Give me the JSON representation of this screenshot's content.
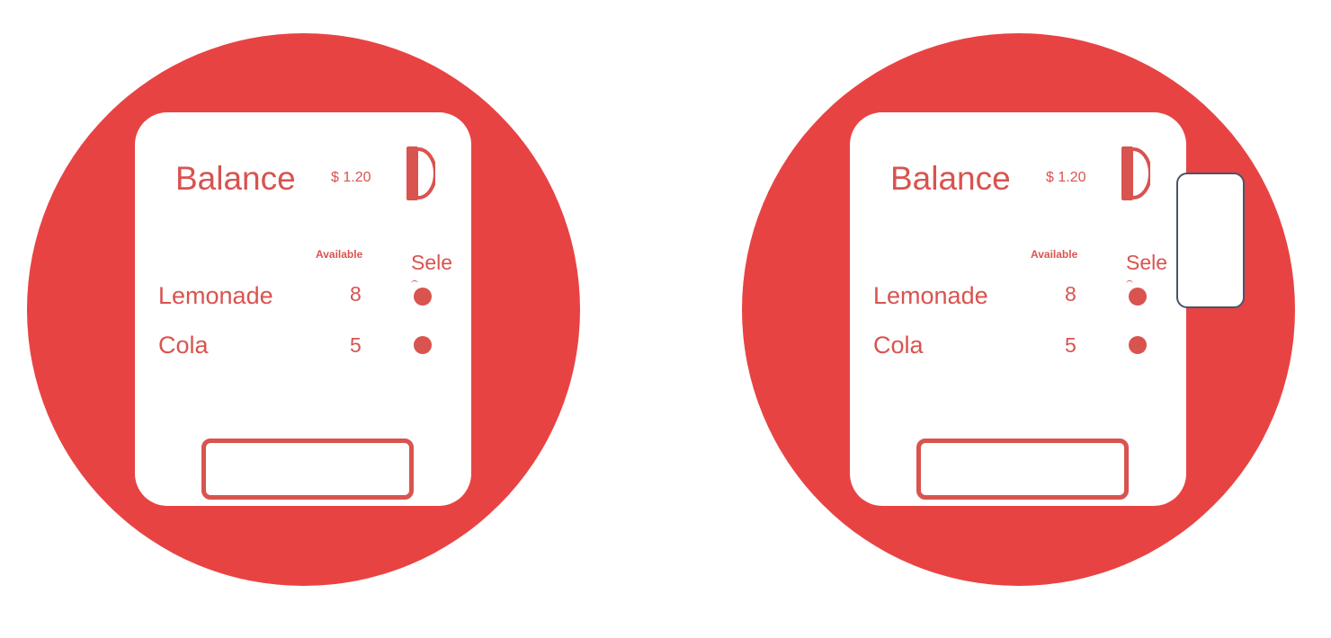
{
  "colors": {
    "machine": "#e84343",
    "text": "#d9534f",
    "panel": "#ffffff",
    "cup_border": "#4a5468"
  },
  "machines": [
    {
      "balance_label": "Balance",
      "balance_value": "$ 1.20",
      "available_header": "Available",
      "select_header": "Sele",
      "items": [
        {
          "name": "Lemonade",
          "available": "8"
        },
        {
          "name": "Cola",
          "available": "5"
        }
      ],
      "coin_slot_icon": "coin-slot-icon",
      "cup_present": false
    },
    {
      "balance_label": "Balance",
      "balance_value": "$ 1.20",
      "available_header": "Available",
      "select_header": "Sele",
      "items": [
        {
          "name": "Lemonade",
          "available": "8"
        },
        {
          "name": "Cola",
          "available": "5"
        }
      ],
      "coin_slot_icon": "coin-slot-icon",
      "cup_present": true
    }
  ]
}
